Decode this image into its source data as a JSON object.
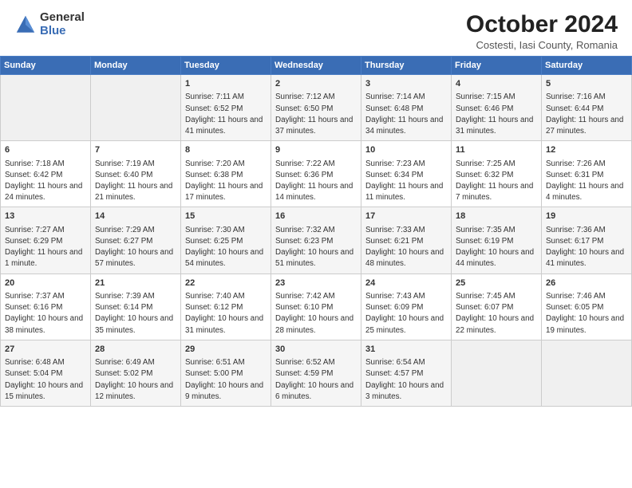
{
  "header": {
    "logo_general": "General",
    "logo_blue": "Blue",
    "month_title": "October 2024",
    "location": "Costesti, Iasi County, Romania"
  },
  "calendar": {
    "days_of_week": [
      "Sunday",
      "Monday",
      "Tuesday",
      "Wednesday",
      "Thursday",
      "Friday",
      "Saturday"
    ],
    "weeks": [
      [
        {
          "day": "",
          "content": ""
        },
        {
          "day": "",
          "content": ""
        },
        {
          "day": "1",
          "content": "Sunrise: 7:11 AM\nSunset: 6:52 PM\nDaylight: 11 hours and 41 minutes."
        },
        {
          "day": "2",
          "content": "Sunrise: 7:12 AM\nSunset: 6:50 PM\nDaylight: 11 hours and 37 minutes."
        },
        {
          "day": "3",
          "content": "Sunrise: 7:14 AM\nSunset: 6:48 PM\nDaylight: 11 hours and 34 minutes."
        },
        {
          "day": "4",
          "content": "Sunrise: 7:15 AM\nSunset: 6:46 PM\nDaylight: 11 hours and 31 minutes."
        },
        {
          "day": "5",
          "content": "Sunrise: 7:16 AM\nSunset: 6:44 PM\nDaylight: 11 hours and 27 minutes."
        }
      ],
      [
        {
          "day": "6",
          "content": "Sunrise: 7:18 AM\nSunset: 6:42 PM\nDaylight: 11 hours and 24 minutes."
        },
        {
          "day": "7",
          "content": "Sunrise: 7:19 AM\nSunset: 6:40 PM\nDaylight: 11 hours and 21 minutes."
        },
        {
          "day": "8",
          "content": "Sunrise: 7:20 AM\nSunset: 6:38 PM\nDaylight: 11 hours and 17 minutes."
        },
        {
          "day": "9",
          "content": "Sunrise: 7:22 AM\nSunset: 6:36 PM\nDaylight: 11 hours and 14 minutes."
        },
        {
          "day": "10",
          "content": "Sunrise: 7:23 AM\nSunset: 6:34 PM\nDaylight: 11 hours and 11 minutes."
        },
        {
          "day": "11",
          "content": "Sunrise: 7:25 AM\nSunset: 6:32 PM\nDaylight: 11 hours and 7 minutes."
        },
        {
          "day": "12",
          "content": "Sunrise: 7:26 AM\nSunset: 6:31 PM\nDaylight: 11 hours and 4 minutes."
        }
      ],
      [
        {
          "day": "13",
          "content": "Sunrise: 7:27 AM\nSunset: 6:29 PM\nDaylight: 11 hours and 1 minute."
        },
        {
          "day": "14",
          "content": "Sunrise: 7:29 AM\nSunset: 6:27 PM\nDaylight: 10 hours and 57 minutes."
        },
        {
          "day": "15",
          "content": "Sunrise: 7:30 AM\nSunset: 6:25 PM\nDaylight: 10 hours and 54 minutes."
        },
        {
          "day": "16",
          "content": "Sunrise: 7:32 AM\nSunset: 6:23 PM\nDaylight: 10 hours and 51 minutes."
        },
        {
          "day": "17",
          "content": "Sunrise: 7:33 AM\nSunset: 6:21 PM\nDaylight: 10 hours and 48 minutes."
        },
        {
          "day": "18",
          "content": "Sunrise: 7:35 AM\nSunset: 6:19 PM\nDaylight: 10 hours and 44 minutes."
        },
        {
          "day": "19",
          "content": "Sunrise: 7:36 AM\nSunset: 6:17 PM\nDaylight: 10 hours and 41 minutes."
        }
      ],
      [
        {
          "day": "20",
          "content": "Sunrise: 7:37 AM\nSunset: 6:16 PM\nDaylight: 10 hours and 38 minutes."
        },
        {
          "day": "21",
          "content": "Sunrise: 7:39 AM\nSunset: 6:14 PM\nDaylight: 10 hours and 35 minutes."
        },
        {
          "day": "22",
          "content": "Sunrise: 7:40 AM\nSunset: 6:12 PM\nDaylight: 10 hours and 31 minutes."
        },
        {
          "day": "23",
          "content": "Sunrise: 7:42 AM\nSunset: 6:10 PM\nDaylight: 10 hours and 28 minutes."
        },
        {
          "day": "24",
          "content": "Sunrise: 7:43 AM\nSunset: 6:09 PM\nDaylight: 10 hours and 25 minutes."
        },
        {
          "day": "25",
          "content": "Sunrise: 7:45 AM\nSunset: 6:07 PM\nDaylight: 10 hours and 22 minutes."
        },
        {
          "day": "26",
          "content": "Sunrise: 7:46 AM\nSunset: 6:05 PM\nDaylight: 10 hours and 19 minutes."
        }
      ],
      [
        {
          "day": "27",
          "content": "Sunrise: 6:48 AM\nSunset: 5:04 PM\nDaylight: 10 hours and 15 minutes."
        },
        {
          "day": "28",
          "content": "Sunrise: 6:49 AM\nSunset: 5:02 PM\nDaylight: 10 hours and 12 minutes."
        },
        {
          "day": "29",
          "content": "Sunrise: 6:51 AM\nSunset: 5:00 PM\nDaylight: 10 hours and 9 minutes."
        },
        {
          "day": "30",
          "content": "Sunrise: 6:52 AM\nSunset: 4:59 PM\nDaylight: 10 hours and 6 minutes."
        },
        {
          "day": "31",
          "content": "Sunrise: 6:54 AM\nSunset: 4:57 PM\nDaylight: 10 hours and 3 minutes."
        },
        {
          "day": "",
          "content": ""
        },
        {
          "day": "",
          "content": ""
        }
      ]
    ]
  }
}
